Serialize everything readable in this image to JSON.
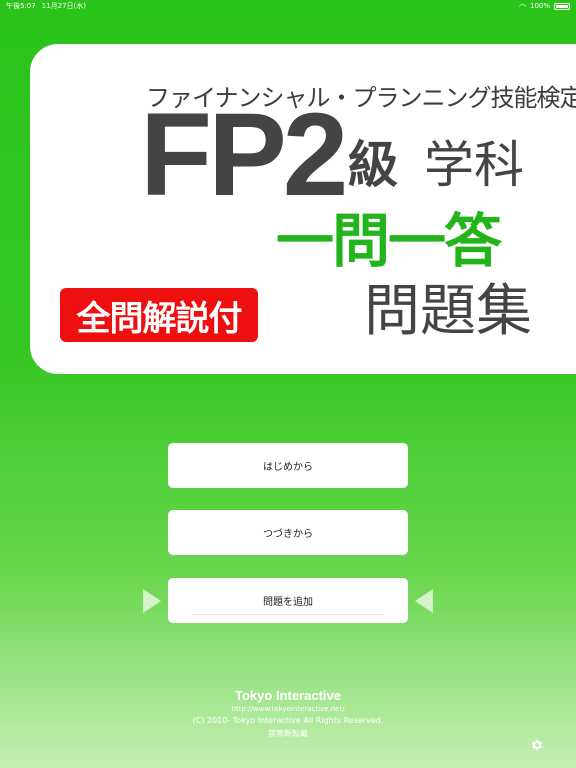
{
  "status_bar": {
    "time": "午後5:07",
    "date": "11月27日(水)",
    "battery": "100%"
  },
  "header": {
    "subtitle": "ファイナンシャル・プランニング技能検定",
    "exam": "FP2",
    "grade": "級",
    "subject": "学科",
    "format": "一問一答",
    "collection": "問題集",
    "badge": "全問解説付"
  },
  "menu": {
    "start_label": "はじめから",
    "continue_label": "つづきから",
    "add_label": "問題を追加"
  },
  "footer": {
    "brand": "Tokyo Interactive",
    "url": "http://www.tokyointeractive.net/",
    "copyright": "(C) 2010- Tokyo Interactive All Rights Reserved.",
    "notice": "禁無断転載"
  },
  "colors": {
    "background_green": "#2ac31a",
    "accent_green": "#22b41a",
    "badge_red": "#ee1010",
    "title_gray": "#444444"
  },
  "icons": {
    "settings": "gear-icon",
    "wifi": "wifi-icon",
    "battery": "battery-icon"
  }
}
